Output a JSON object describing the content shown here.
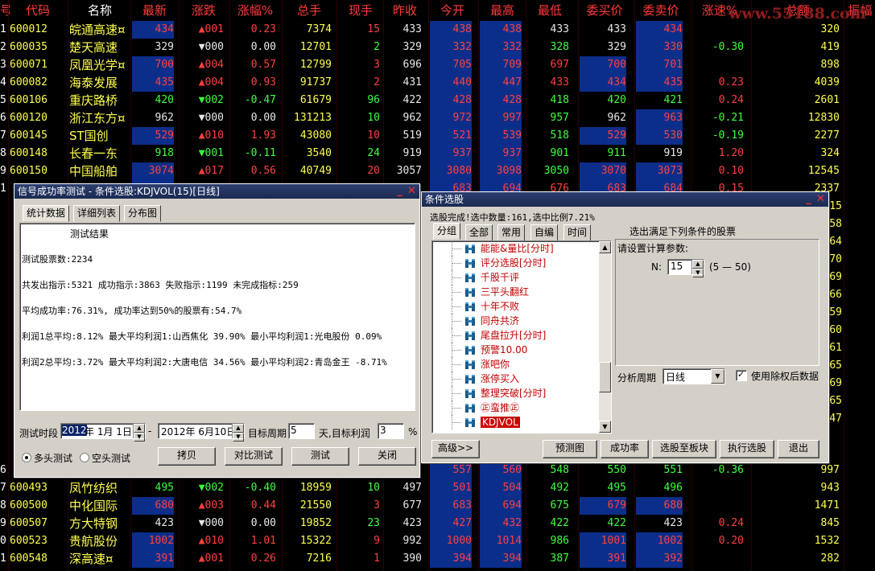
{
  "columns": [
    "号",
    "代码",
    "名称",
    "最新",
    "涨跌",
    "涨幅%",
    "总手",
    "现手",
    "昨收",
    "今开",
    "最高",
    "最低",
    "委买价",
    "委卖价",
    "涨速%",
    "总额",
    "振幅"
  ],
  "watermark": "www.55188.com",
  "rows_top": [
    {
      "idx": "1",
      "code": "600012",
      "name": "皖通高速",
      "mark": "¤",
      "last": "434",
      "chg": "▲001",
      "pct": "0.23",
      "vol": "7374",
      "cur": "15",
      "prev": "433",
      "open": "438",
      "high": "438",
      "low": "433",
      "bid": "433",
      "ask": "434",
      "spd": "",
      "amt": "320",
      "dir": "up"
    },
    {
      "idx": "2",
      "code": "600035",
      "name": "楚天高速",
      "mark": "",
      "last": "329",
      "chg": "▼000",
      "pct": "0.00",
      "vol": "12701",
      "cur": "2",
      "prev": "329",
      "open": "332",
      "high": "332",
      "low": "328",
      "bid": "329",
      "ask": "330",
      "spd": "-0.30",
      "amt": "419",
      "dir": "eq"
    },
    {
      "idx": "3",
      "code": "600071",
      "name": "凤凰光学",
      "mark": "¤",
      "last": "700",
      "chg": "▲004",
      "pct": "0.57",
      "vol": "12799",
      "cur": "3",
      "prev": "696",
      "open": "705",
      "high": "709",
      "low": "697",
      "bid": "700",
      "ask": "701",
      "spd": "",
      "amt": "898",
      "dir": "up"
    },
    {
      "idx": "4",
      "code": "600082",
      "name": "海泰发展",
      "mark": "",
      "last": "435",
      "chg": "▲004",
      "pct": "0.93",
      "vol": "91737",
      "cur": "2",
      "prev": "431",
      "open": "440",
      "high": "447",
      "low": "433",
      "bid": "434",
      "ask": "435",
      "spd": "0.23",
      "amt": "4039",
      "dir": "up"
    },
    {
      "idx": "5",
      "code": "600106",
      "name": "重庆路桥",
      "mark": "",
      "last": "420",
      "chg": "▼002",
      "pct": "-0.47",
      "vol": "61679",
      "cur": "96",
      "prev": "422",
      "open": "428",
      "high": "428",
      "low": "418",
      "bid": "420",
      "ask": "421",
      "spd": "0.24",
      "amt": "2601",
      "dir": "dn"
    },
    {
      "idx": "6",
      "code": "600120",
      "name": "浙江东方",
      "mark": "¤",
      "last": "962",
      "chg": "▼000",
      "pct": "0.00",
      "vol": "131213",
      "cur": "10",
      "prev": "962",
      "open": "972",
      "high": "997",
      "low": "957",
      "bid": "962",
      "ask": "963",
      "spd": "-0.21",
      "amt": "12830",
      "dir": "eq"
    },
    {
      "idx": "7",
      "code": "600145",
      "name": "ST国创",
      "mark": "",
      "last": "529",
      "chg": "▲010",
      "pct": "1.93",
      "vol": "43080",
      "cur": "10",
      "prev": "519",
      "open": "521",
      "high": "539",
      "low": "518",
      "bid": "529",
      "ask": "530",
      "spd": "-0.19",
      "amt": "2277",
      "dir": "up"
    },
    {
      "idx": "8",
      "code": "600148",
      "name": "长春一东",
      "mark": "",
      "last": "918",
      "chg": "▼001",
      "pct": "-0.11",
      "vol": "3540",
      "cur": "24",
      "prev": "919",
      "open": "937",
      "high": "937",
      "low": "901",
      "bid": "911",
      "ask": "919",
      "spd": "1.20",
      "amt": "324",
      "dir": "dn"
    },
    {
      "idx": "9",
      "code": "600150",
      "name": "中国船舶",
      "mark": "",
      "last": "3074",
      "chg": "▲017",
      "pct": "0.56",
      "vol": "40749",
      "cur": "20",
      "prev": "3057",
      "open": "3080",
      "high": "3098",
      "low": "3050",
      "bid": "3070",
      "ask": "3073",
      "spd": "0.10",
      "amt": "12545",
      "dir": "up"
    },
    {
      "idx": "10",
      "code": "",
      "name": "",
      "mark": "",
      "last": "",
      "chg": "",
      "pct": "",
      "vol": "",
      "cur": "",
      "prev": "",
      "open": "683",
      "high": "694",
      "low": "676",
      "bid": "683",
      "ask": "684",
      "spd": "0.15",
      "amt": "2337",
      "dir": "up"
    }
  ],
  "rows_bottom": [
    {
      "idx": "6",
      "code": "",
      "name": "",
      "mark": "",
      "last": "",
      "chg": "",
      "pct": "",
      "vol": "",
      "cur": "",
      "prev": "552",
      "open": "557",
      "high": "560",
      "low": "548",
      "bid": "550",
      "ask": "551",
      "spd": "-0.36",
      "amt": "997",
      "dir": "up"
    },
    {
      "idx": "7",
      "code": "600493",
      "name": "凤竹纺织",
      "mark": "",
      "last": "495",
      "chg": "▼002",
      "pct": "-0.40",
      "vol": "18959",
      "cur": "10",
      "prev": "497",
      "open": "501",
      "high": "504",
      "low": "492",
      "bid": "495",
      "ask": "496",
      "spd": "",
      "amt": "943",
      "dir": "dn"
    },
    {
      "idx": "8",
      "code": "600500",
      "name": "中化国际",
      "mark": "",
      "last": "680",
      "chg": "▲003",
      "pct": "0.44",
      "vol": "21550",
      "cur": "3",
      "prev": "677",
      "open": "683",
      "high": "694",
      "low": "675",
      "bid": "679",
      "ask": "680",
      "spd": "",
      "amt": "1471",
      "dir": "up"
    },
    {
      "idx": "9",
      "code": "600507",
      "name": "方大特钢",
      "mark": "",
      "last": "423",
      "chg": "▼000",
      "pct": "0.00",
      "vol": "19852",
      "cur": "23",
      "prev": "423",
      "open": "427",
      "high": "432",
      "low": "422",
      "bid": "422",
      "ask": "423",
      "spd": "0.24",
      "amt": "845",
      "dir": "eq"
    },
    {
      "idx": "0",
      "code": "600523",
      "name": "贵航股份",
      "mark": "",
      "last": "1002",
      "chg": "▲010",
      "pct": "1.01",
      "vol": "15322",
      "cur": "9",
      "prev": "992",
      "open": "1000",
      "high": "1014",
      "low": "986",
      "bid": "1001",
      "ask": "1002",
      "spd": "0.20",
      "amt": "1532",
      "dir": "up"
    },
    {
      "idx": "1",
      "code": "600548",
      "name": "深高速",
      "mark": "¤",
      "last": "391",
      "chg": "▲001",
      "pct": "0.26",
      "vol": "7216",
      "cur": "1",
      "prev": "390",
      "open": "394",
      "high": "394",
      "low": "387",
      "bid": "391",
      "ask": "392",
      "spd": "",
      "amt": "282",
      "dir": "up"
    }
  ],
  "side_values": [
    "15",
    "58",
    "64",
    "70",
    "69",
    "66",
    "59",
    "60",
    "61",
    "65",
    "69",
    "65",
    "47"
  ],
  "signal_window": {
    "title": "信号成功率测试 - 条件选股:KDJVOL(15)[日线]",
    "tabs": [
      "统计数据",
      "详细列表",
      "分布图"
    ],
    "result_title": "测试结果",
    "lines": [
      "测试股票数:2234",
      "共发出指示:5321 成功指示:3863 失败指示:1199 未完成指标:259",
      "平均成功率:76.31%, 成功率达到50%的股票有:54.7%",
      "利润1总平均:8.12% 最大平均利润1:山西焦化 39.90% 最小平均利润1:光电股份 0.09%",
      "利润2总平均:3.72% 最大平均利润2:大唐电信 34.56% 最小平均利润2:青岛金王 -8.71%"
    ],
    "period_label": "测试时段",
    "start_year": "2012",
    "start_rest": "年  1月  1日",
    "dash": "-",
    "end_date": "2012年  6月10日",
    "target_period_label": "目标周期",
    "target_period": "5",
    "target_profit_label": "天,目标利润",
    "target_profit": "3",
    "percent": "%",
    "radio_long": "多头测试",
    "radio_short": "空头测试",
    "buttons": [
      "拷贝",
      "对比测试",
      "测试",
      "关闭"
    ]
  },
  "select_window": {
    "title": "条件选股",
    "status": "选股完成!选中数量:161,选中比例7.21%",
    "tabs": [
      "分组",
      "全部",
      "常用",
      "自编",
      "时间"
    ],
    "tree_items": [
      "能能&量比[分时]",
      "评分选股[分时]",
      "千股千评",
      "三平头翻红",
      "十年不败",
      "同舟共济",
      "尾盘拉升[分时]",
      "预警10.00",
      "涨吧你",
      "涨停买入",
      "整理突破[分时]",
      "㊣蛮推㊣",
      "KDJVOL"
    ],
    "criteria_title": "选出满足下列条件的股票",
    "param_title": "请设置计算参数:",
    "param_name": "N:",
    "param_value": "15",
    "param_range": "(5 — 50)",
    "period_label": "分析周期",
    "period_value": "日线",
    "checkbox_label": "使用除权后数据",
    "checkbox_mark": "✓",
    "buttons": [
      "高级>>",
      "预测图",
      "成功率",
      "选股至板块",
      "执行选股",
      "退出"
    ]
  },
  "colors": {
    "up": "#ff4040",
    "down": "#3fff3f",
    "flat": "#e8e8e8",
    "code": "#ffff4e",
    "header": "#ff3a3a"
  }
}
